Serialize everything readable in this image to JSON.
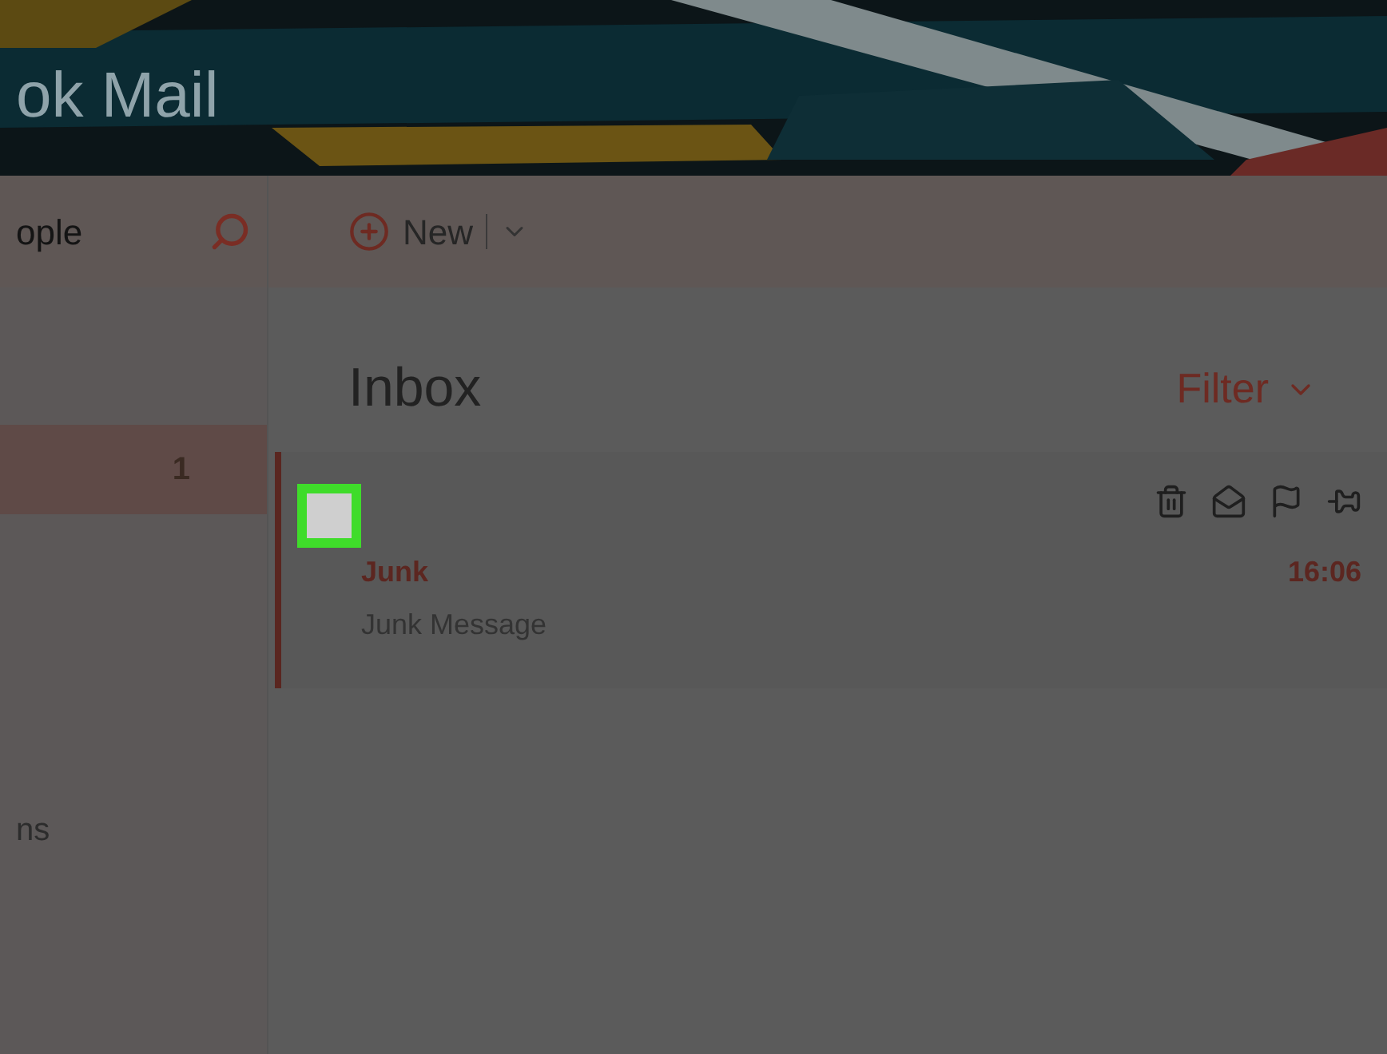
{
  "header": {
    "title": "ok Mail"
  },
  "search": {
    "placeholder": "ople"
  },
  "toolbar": {
    "new_label": "New"
  },
  "sidebar": {
    "items": [
      {
        "count": "1",
        "selected": true
      },
      {
        "label": "ns",
        "selected": false
      }
    ]
  },
  "inbox": {
    "title": "Inbox",
    "filter": "Filter",
    "messages": [
      {
        "folder": "Junk",
        "time": "16:06",
        "preview": "Junk Message",
        "checked": false,
        "selected": true
      }
    ]
  }
}
